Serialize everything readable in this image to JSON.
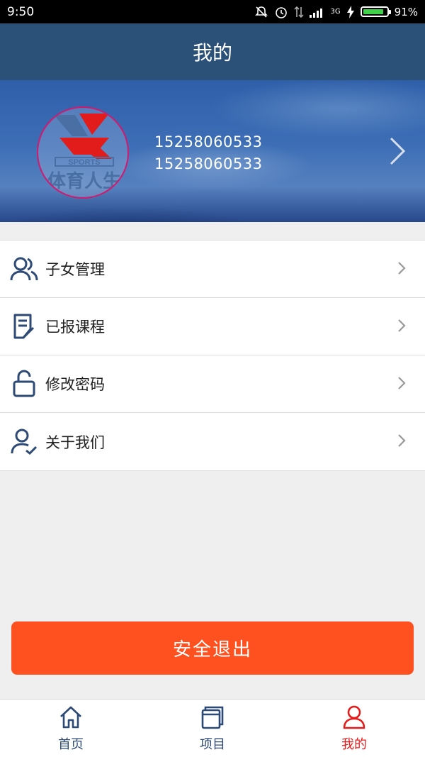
{
  "status_bar": {
    "time": "9:50",
    "battery": "91%",
    "battery_level": 0.91,
    "network": "3G",
    "icons": [
      "silent-icon",
      "alarm-icon",
      "data-transfer-icon",
      "signal-icon",
      "charging-icon",
      "battery-icon"
    ]
  },
  "header": {
    "title": "我的"
  },
  "profile": {
    "avatar_logo_text": "SPORTS",
    "avatar_logo_caption": "体育人生",
    "phone": "15258060533",
    "username": "15258060533"
  },
  "menu": {
    "items": [
      {
        "label": "子女管理",
        "icon": "users-icon"
      },
      {
        "label": "已报课程",
        "icon": "document-icon"
      },
      {
        "label": "修改密码",
        "icon": "lock-icon"
      },
      {
        "label": "关于我们",
        "icon": "user-check-icon"
      }
    ]
  },
  "logout": {
    "label": "安全退出"
  },
  "tabbar": {
    "tabs": [
      {
        "label": "首页",
        "icon": "home-icon",
        "active": false
      },
      {
        "label": "项目",
        "icon": "files-icon",
        "active": false
      },
      {
        "label": "我的",
        "icon": "user-icon",
        "active": true
      }
    ]
  },
  "colors": {
    "header_bg": "#2c5179",
    "accent": "#ff5020",
    "tab_active": "#e61b1b",
    "tab_inactive": "#2c4a75",
    "icon_color": "#2c4a75"
  }
}
